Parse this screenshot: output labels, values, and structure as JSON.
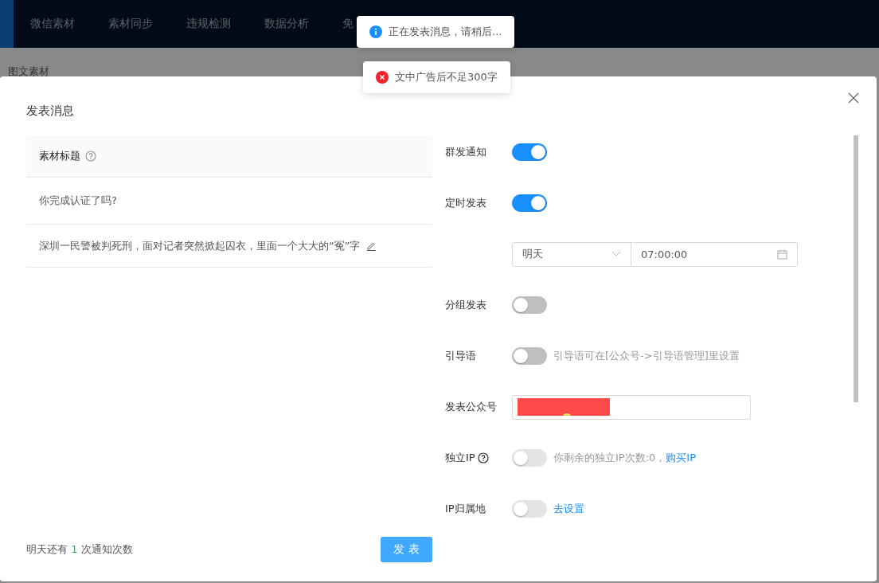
{
  "nav": {
    "items": [
      "微信素材",
      "素材同步",
      "违规检测",
      "数据分析",
      "免"
    ]
  },
  "breadcrumb": "图文素材",
  "toasts": [
    {
      "kind": "info",
      "text": "正在发表消息，请稍后..."
    },
    {
      "kind": "error",
      "text": "文中广告后不足300字"
    }
  ],
  "dialog": {
    "title": "发表消息",
    "table": {
      "header": "素材标题",
      "rows": [
        {
          "text": "你完成认证了吗?",
          "editable": false
        },
        {
          "text": "深圳一民警被判死刑，面对记者突然掀起囚衣，里面一个大大的“冤”字",
          "editable": true
        }
      ]
    },
    "footer": {
      "prefix": "明天还有",
      "count": "1",
      "suffix": "次通知次数"
    },
    "publish_button": "发 表",
    "settings": [
      {
        "kind": "toggle",
        "label": "群发通知",
        "on": true,
        "disabled": false
      },
      {
        "kind": "toggle",
        "label": "定时发表",
        "on": true,
        "disabled": false
      },
      {
        "kind": "schedule",
        "day": "明天",
        "time": "07:00:00"
      },
      {
        "kind": "toggle",
        "label": "分组发表",
        "on": false,
        "disabled": false
      },
      {
        "kind": "toggle",
        "label": "引导语",
        "on": false,
        "disabled": false,
        "hint": "引导语可在[公众号->引导语管理]里设置"
      },
      {
        "kind": "account",
        "label": "发表公众号"
      },
      {
        "kind": "toggle",
        "label": "独立IP",
        "help": true,
        "on": false,
        "disabled": true,
        "hint": "你剩余的独立IP次数:0，",
        "link": "购买IP"
      },
      {
        "kind": "toggle",
        "label": "IP归属地",
        "on": false,
        "disabled": true,
        "link": "去设置"
      }
    ]
  }
}
